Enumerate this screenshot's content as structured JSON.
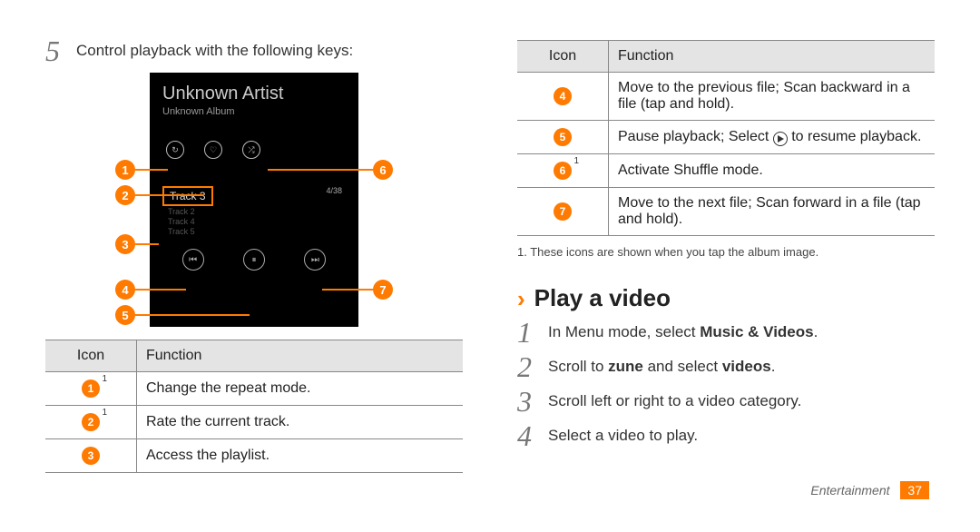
{
  "left": {
    "step5_num": "5",
    "step5_text": "Control playback with the following keys:",
    "phone": {
      "artist": "Unknown Artist",
      "album": "Unknown Album",
      "track_current": "Track 3",
      "track_others": [
        "Track 2",
        "Track 4",
        "Track 5"
      ],
      "track_count": "4/38"
    },
    "callouts": [
      "1",
      "2",
      "3",
      "4",
      "5",
      "6",
      "7"
    ],
    "table": {
      "h_icon": "Icon",
      "h_func": "Function",
      "rows": [
        {
          "num": "1",
          "sup": "1",
          "func": "Change the repeat mode."
        },
        {
          "num": "2",
          "sup": "1",
          "func": "Rate the current track."
        },
        {
          "num": "3",
          "sup": "",
          "func": "Access the playlist."
        }
      ]
    }
  },
  "right": {
    "table": {
      "h_icon": "Icon",
      "h_func": "Function",
      "rows": [
        {
          "num": "4",
          "sup": "",
          "func": "Move to the previous file; Scan backward in a file (tap and hold)."
        },
        {
          "num": "5",
          "sup": "",
          "func_pre": "Pause playback; Select ",
          "func_post": " to resume playback."
        },
        {
          "num": "6",
          "sup": "1",
          "func": "Activate Shuffle mode."
        },
        {
          "num": "7",
          "sup": "",
          "func": "Move to the next file; Scan forward in a file (tap and hold)."
        }
      ]
    },
    "footnote": "1. These icons are shown when you tap the album image.",
    "subhead": "Play a video",
    "steps": [
      {
        "n": "1",
        "pre": "In Menu mode, select ",
        "bold": "Music & Videos",
        "post": "."
      },
      {
        "n": "2",
        "pre": "Scroll to ",
        "bold": "zune",
        "mid": " and select ",
        "bold2": "videos",
        "post": "."
      },
      {
        "n": "3",
        "text": "Scroll left or right to a video category."
      },
      {
        "n": "4",
        "text": "Select a video to play."
      }
    ],
    "footer_cat": "Entertainment",
    "footer_page": "37"
  }
}
